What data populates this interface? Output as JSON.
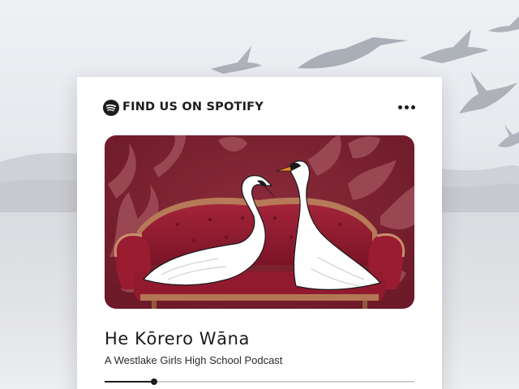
{
  "card": {
    "brand_label": "FIND US ON SPOTIFY",
    "more_icon": "more-horizontal-icon",
    "spotify_icon": "spotify-icon"
  },
  "episode": {
    "title": "He Kōrero Wāna",
    "subtitle": "A Westlake Girls High School Podcast",
    "progress_fraction": 0.16
  },
  "colors": {
    "accent": "#1d1d1d",
    "artwork_bg": "#7e2232",
    "sofa": "#9c1f33",
    "track": "#c9ccd2"
  }
}
